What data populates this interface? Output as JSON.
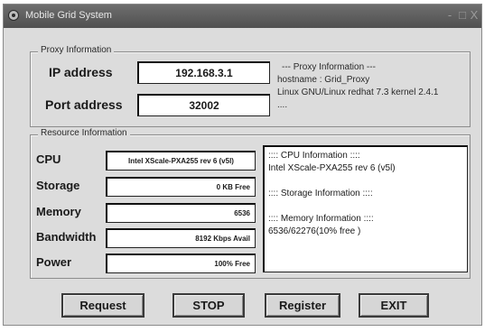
{
  "window": {
    "title": "Mobile Grid System",
    "controls": [
      "-",
      "□",
      "X"
    ]
  },
  "proxy": {
    "caption": "Proxy Information",
    "ip_label": "IP address",
    "ip_value": "192.168.3.1",
    "port_label": "Port address",
    "port_value": "32002",
    "info_lines": [
      "--- Proxy Information ---",
      "hostname : Grid_Proxy",
      "Linux GNU/Linux redhat 7.3 kernel 2.4.1",
      "...."
    ]
  },
  "resource": {
    "caption": "Resource Information",
    "rows": [
      {
        "label": "CPU",
        "value": "Intel XScale-PXA255 rev 6 (v5l)"
      },
      {
        "label": "Storage",
        "value": "0 KB Free"
      },
      {
        "label": "Memory",
        "value": "6536"
      },
      {
        "label": "Bandwidth",
        "value": "8192 Kbps Avail"
      },
      {
        "label": "Power",
        "value": "100% Free"
      }
    ],
    "detail_text": ":::: CPU Information ::::\nIntel XScale-PXA255 rev 6 (v5l)\n\n:::: Storage Information ::::\n\n:::: Memory Information ::::\n6536/62276(10% free )"
  },
  "buttons": {
    "request": "Request",
    "stop": "STOP",
    "register": "Register",
    "exit": "EXIT"
  }
}
